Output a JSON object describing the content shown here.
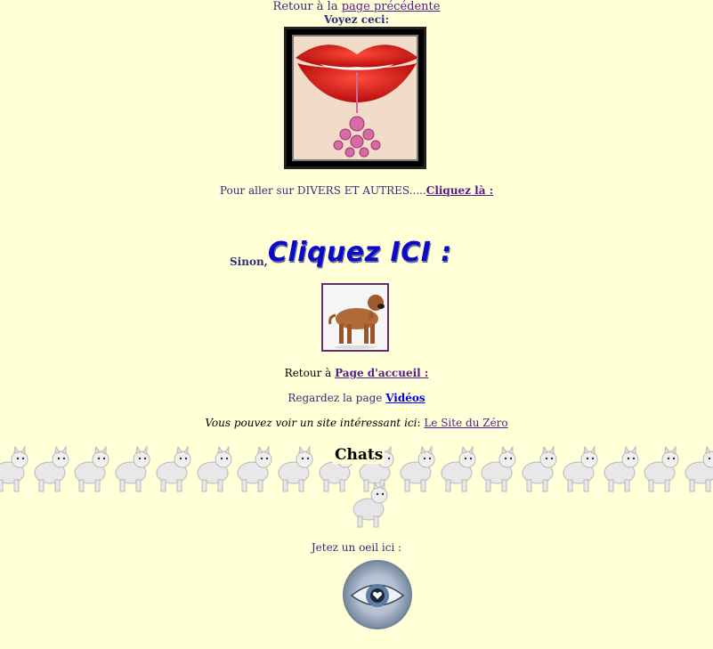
{
  "nav": {
    "retour_prefix": "Retour à la ",
    "retour_link": "page précédente",
    "voyez": "Voyez ceci:"
  },
  "divers": {
    "text": "Pour aller sur DIVERS ET AUTRES.....",
    "link": "Cliquez là :"
  },
  "sinon": {
    "prefix": "Sinon,",
    "big_link": "Cliquez ICI :"
  },
  "accueil": {
    "prefix": "Retour à ",
    "link": "Page d'accueil :"
  },
  "videos": {
    "prefix": "Regardez la page ",
    "link": "Vidéos"
  },
  "site": {
    "prefix": "Vous pouvez voir un site intéressant ici",
    "colon": ": ",
    "link": "Le Site du Zéro"
  },
  "cats": {
    "title": "Chats"
  },
  "eye": {
    "text": "Jetez un oeil ici :"
  },
  "colors": {
    "background": "#ffffd8",
    "text": "#30307a",
    "visited_link": "#551a8b",
    "link": "#0000ee",
    "big_link": "#0a0ac8"
  }
}
